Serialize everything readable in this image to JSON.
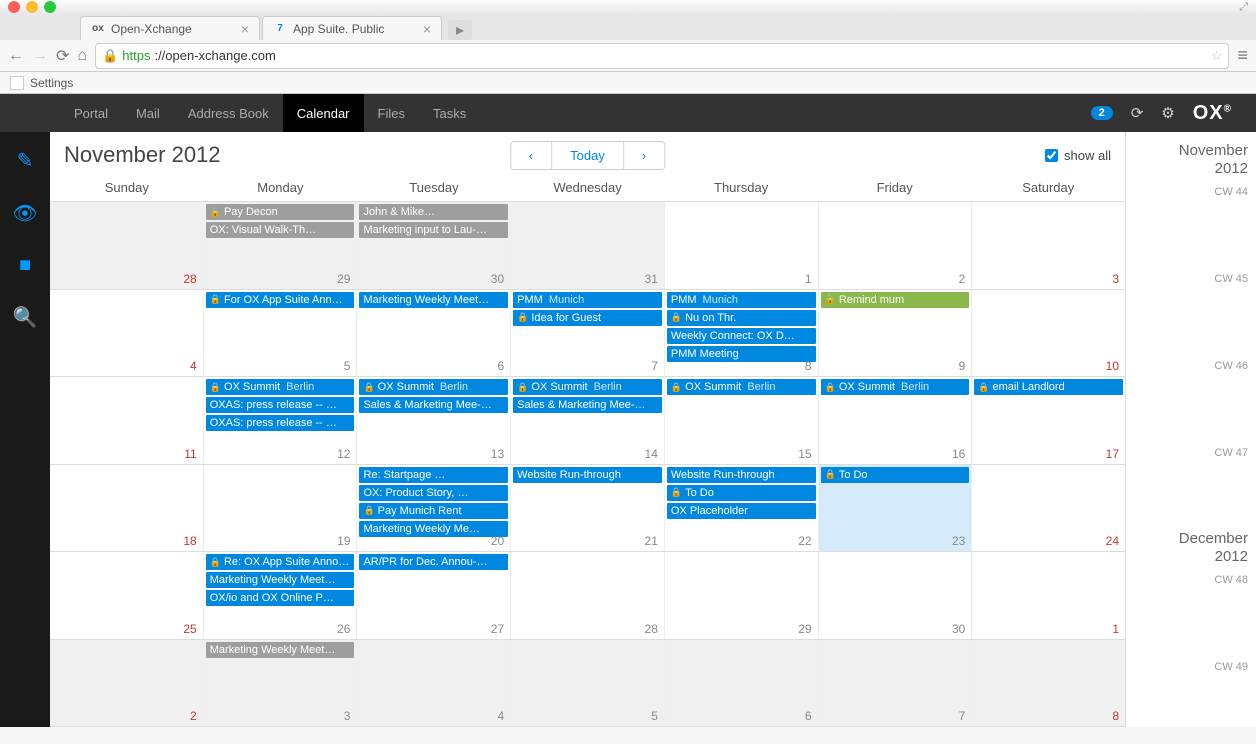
{
  "browser": {
    "tabs": [
      {
        "favicon": "OX",
        "label": "Open-Xchange"
      },
      {
        "favicon": "7",
        "label": "App Suite. Public"
      }
    ],
    "url_proto": "https",
    "url_rest": "://open-xchange.com",
    "bookmark": "Settings"
  },
  "topnav": {
    "items": [
      "Portal",
      "Mail",
      "Address Book",
      "Calendar",
      "Files",
      "Tasks"
    ],
    "active": "Calendar",
    "badge": "2",
    "logo": "OX"
  },
  "header": {
    "title": "November 2012",
    "today": "Today",
    "showall": "show all"
  },
  "dayheaders": [
    "Sunday",
    "Monday",
    "Tuesday",
    "Wednesday",
    "Thursday",
    "Friday",
    "Saturday"
  ],
  "minical": {
    "months": [
      {
        "name": "November",
        "year": "2012"
      },
      {
        "name": "December",
        "year": "2012"
      }
    ],
    "cws": [
      "CW 44",
      "CW 45",
      "CW 46",
      "CW 47",
      "CW 48",
      "CW 49"
    ]
  },
  "weeks": [
    {
      "days": [
        {
          "num": "28",
          "outside": true,
          "red": true
        },
        {
          "num": "29",
          "outside": true,
          "events": [
            {
              "t": "Pay Decon",
              "c": "gray",
              "lock": true
            },
            {
              "t": "OX: Visual Walk-Th…",
              "c": "gray"
            }
          ]
        },
        {
          "num": "30",
          "outside": true,
          "events": [
            {
              "t": "John & Mike…",
              "c": "gray"
            },
            {
              "t": "Marketing input to Lau-…",
              "c": "gray"
            }
          ]
        },
        {
          "num": "31",
          "outside": true
        },
        {
          "num": "1"
        },
        {
          "num": "2"
        },
        {
          "num": "3",
          "red": true
        }
      ]
    },
    {
      "days": [
        {
          "num": "4",
          "red": true
        },
        {
          "num": "5",
          "events": [
            {
              "t": "For OX App Suite Ann…",
              "c": "blue",
              "lock": true
            }
          ]
        },
        {
          "num": "6",
          "events": [
            {
              "t": "Marketing Weekly Meet…",
              "c": "blue"
            }
          ]
        },
        {
          "num": "7",
          "events": [
            {
              "t": "PMM",
              "loc": "Munich",
              "c": "blue"
            },
            {
              "t": "Idea for Guest",
              "c": "blue",
              "lock": true
            }
          ]
        },
        {
          "num": "8",
          "events": [
            {
              "t": "PMM",
              "loc": "Munich",
              "c": "blue"
            },
            {
              "t": "Nu on Thr.",
              "c": "blue",
              "lock": true
            },
            {
              "t": "Weekly Connect: OX D…",
              "c": "blue"
            },
            {
              "t": "PMM Meeting",
              "c": "blue"
            }
          ]
        },
        {
          "num": "9",
          "events": [
            {
              "t": "Remind mum",
              "c": "green",
              "lock": true
            }
          ]
        },
        {
          "num": "10",
          "red": true
        }
      ]
    },
    {
      "days": [
        {
          "num": "11",
          "red": true
        },
        {
          "num": "12",
          "events": [
            {
              "t": "OX Summit",
              "loc": "Berlin",
              "c": "blue",
              "lock": true
            },
            {
              "t": "OXAS: press release -- …",
              "c": "blue"
            },
            {
              "t": "OXAS: press release -- …",
              "c": "blue"
            }
          ]
        },
        {
          "num": "13",
          "events": [
            {
              "t": "OX Summit",
              "loc": "Berlin",
              "c": "blue",
              "lock": true
            },
            {
              "t": "Sales & Marketing Mee-…",
              "c": "blue"
            }
          ]
        },
        {
          "num": "14",
          "events": [
            {
              "t": "OX Summit",
              "loc": "Berlin",
              "c": "blue",
              "lock": true
            },
            {
              "t": "Sales & Marketing Mee-…",
              "c": "blue"
            }
          ]
        },
        {
          "num": "15",
          "events": [
            {
              "t": "OX Summit",
              "loc": "Berlin",
              "c": "blue",
              "lock": true
            }
          ]
        },
        {
          "num": "16",
          "events": [
            {
              "t": "OX Summit",
              "loc": "Berlin",
              "c": "blue",
              "lock": true
            }
          ]
        },
        {
          "num": "17",
          "red": true,
          "events": [
            {
              "t": "email Landlord",
              "c": "blue",
              "lock": true
            }
          ]
        }
      ]
    },
    {
      "days": [
        {
          "num": "18",
          "red": true
        },
        {
          "num": "19"
        },
        {
          "num": "20",
          "events": [
            {
              "t": "Re: Startpage …",
              "c": "blue"
            },
            {
              "t": "OX: Product Story, …",
              "c": "blue"
            },
            {
              "t": "Pay Munich Rent",
              "c": "blue",
              "lock": true
            },
            {
              "t": "Marketing Weekly Me…",
              "c": "blue"
            }
          ]
        },
        {
          "num": "21",
          "events": [
            {
              "t": "Website Run-through",
              "c": "blue"
            }
          ]
        },
        {
          "num": "22",
          "events": [
            {
              "t": "Website Run-through",
              "c": "blue"
            },
            {
              "t": "To Do",
              "c": "blue",
              "lock": true
            },
            {
              "t": "OX Placeholder",
              "c": "blue"
            }
          ]
        },
        {
          "num": "23",
          "today": true,
          "events": [
            {
              "t": "To Do",
              "c": "blue",
              "lock": true
            }
          ]
        },
        {
          "num": "24",
          "red": true
        }
      ]
    },
    {
      "days": [
        {
          "num": "25",
          "red": true
        },
        {
          "num": "26",
          "events": [
            {
              "t": "Re: OX App Suite Anno…",
              "c": "blue",
              "lock": true
            },
            {
              "t": "Marketing Weekly Meet…",
              "c": "blue"
            },
            {
              "t": "OX/io and OX Online P…",
              "c": "blue"
            }
          ]
        },
        {
          "num": "27",
          "events": [
            {
              "t": "AR/PR for Dec. Annou-…",
              "c": "blue"
            }
          ]
        },
        {
          "num": "28"
        },
        {
          "num": "29"
        },
        {
          "num": "30"
        },
        {
          "num": "1",
          "red": true
        }
      ]
    },
    {
      "days": [
        {
          "num": "2",
          "red": true,
          "outside": true
        },
        {
          "num": "3",
          "outside": true,
          "events": [
            {
              "t": "Marketing Weekly Meet…",
              "c": "gray"
            }
          ]
        },
        {
          "num": "4",
          "outside": true
        },
        {
          "num": "5",
          "outside": true
        },
        {
          "num": "6",
          "outside": true
        },
        {
          "num": "7",
          "outside": true
        },
        {
          "num": "8",
          "outside": true,
          "red": true
        }
      ]
    }
  ]
}
